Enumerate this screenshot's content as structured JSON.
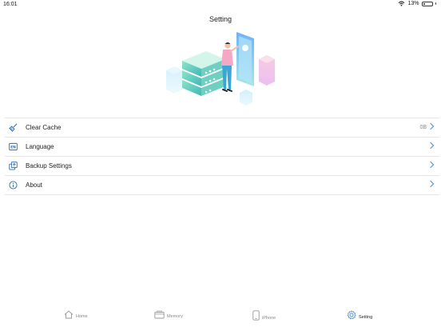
{
  "status_bar": {
    "time": "16:01",
    "battery_text": "13%"
  },
  "page_title": "Setting",
  "settings": [
    {
      "label": "Clear Cache",
      "value": "0B",
      "icon": "broom-icon"
    },
    {
      "label": "Language",
      "value": "",
      "icon": "en-language-icon"
    },
    {
      "label": "Backup Settings",
      "value": "",
      "icon": "backup-icon"
    },
    {
      "label": "About",
      "value": "",
      "icon": "info-icon"
    }
  ],
  "tabs": [
    {
      "label": "Home",
      "icon": "home-icon",
      "active": false
    },
    {
      "label": "Memory",
      "icon": "memory-icon",
      "active": false
    },
    {
      "label": "iPhone",
      "icon": "iphone-icon",
      "active": false
    },
    {
      "label": "Setting",
      "icon": "settings-gear-icon",
      "active": true
    }
  ],
  "colors": {
    "accent": "#4a8fd6",
    "divider": "#e6e6e6",
    "inactive_tab": "#888888"
  }
}
